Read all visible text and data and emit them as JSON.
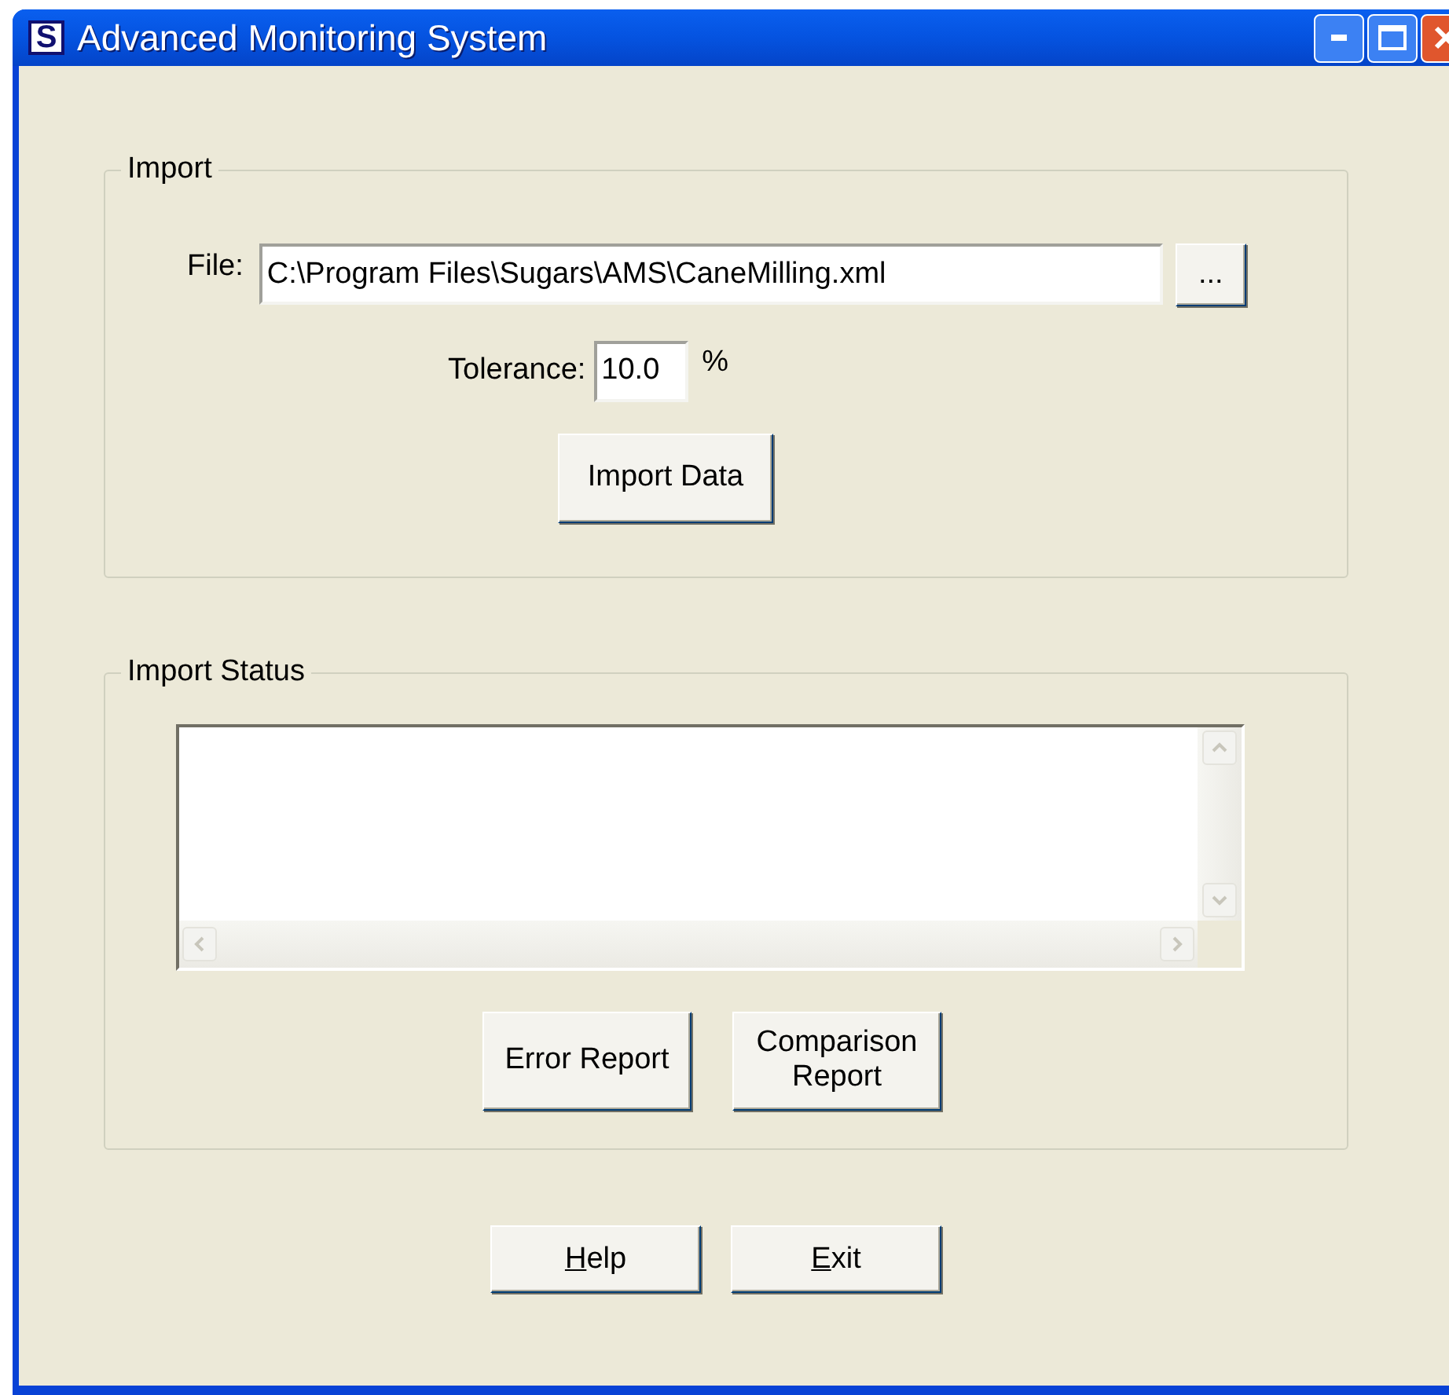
{
  "window": {
    "title": "Advanced Monitoring System",
    "app_icon_letter": "S"
  },
  "import": {
    "legend": "Import",
    "file_label": "File:",
    "file_value": "C:\\Program Files\\Sugars\\AMS\\CaneMilling.xml",
    "browse_button": "...",
    "tolerance_label": "Tolerance:",
    "tolerance_value": "10.0",
    "tolerance_unit": "%",
    "import_button": "Import Data"
  },
  "import_status": {
    "legend": "Import Status",
    "buttons": [
      {
        "label": "Error Report"
      },
      {
        "label": "Comparison Report"
      }
    ]
  },
  "footer_buttons": [
    {
      "access_key": "H",
      "label_rest": "elp"
    },
    {
      "access_key": "E",
      "label_rest": "xit"
    }
  ]
}
